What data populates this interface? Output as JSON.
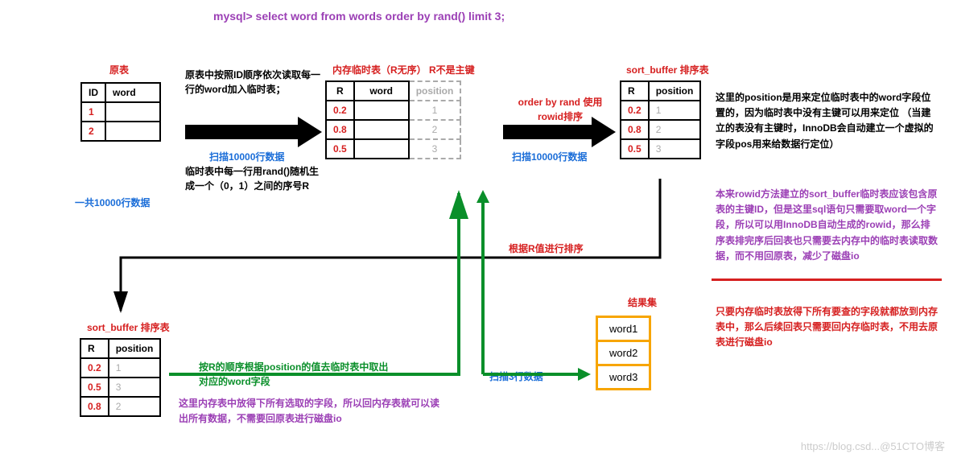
{
  "sql": "mysql> select word from words order by rand() limit 3;",
  "original": {
    "title": "原表",
    "headers": [
      "ID",
      "word"
    ],
    "rows": [
      [
        "1",
        ""
      ],
      [
        "2",
        ""
      ]
    ],
    "caption": "一共10000行数据"
  },
  "step1": {
    "desc": "原表中按照ID顺序依次读取每一行的word加入临时表；",
    "scan": "扫描10000行数据",
    "rand": "临时表中每一行用rand()随机生成一个（0，1）之间的序号R"
  },
  "temp": {
    "title": "内存临时表（R无序） R不是主键",
    "headers": [
      "R",
      "word",
      "position"
    ],
    "rows": [
      [
        "0.2",
        "",
        "1"
      ],
      [
        "0.8",
        "",
        "2"
      ],
      [
        "0.5",
        "",
        "3"
      ]
    ]
  },
  "step2": {
    "desc": "order by rand 使用rowid排序",
    "scan": "扫描10000行数据",
    "sortnote": "根据R值进行排序"
  },
  "sortbuf1": {
    "title": "sort_buffer 排序表",
    "headers": [
      "R",
      "position"
    ],
    "rows": [
      [
        "0.2",
        "1"
      ],
      [
        "0.8",
        "2"
      ],
      [
        "0.5",
        "3"
      ]
    ]
  },
  "note1": "这里的position是用来定位临时表中的word字段位置的，因为临时表中没有主键可以用来定位\n（当建立的表没有主键时，InnoDB会自动建立一个虚拟的字段pos用来给数据行定位）",
  "note2": "本来rowid方法建立的sort_buffer临时表应该包含原表的主键ID，但是这里sql语句只需要取word一个字段，所以可以用InnoDB自动生成的rowid，那么排序表排完序后回表也只需要去内存中的临时表读取数据，而不用回原表，减少了磁盘io",
  "note3": "只要内存临时表放得下所有要查的字段就都放到内存表中，那么后续回表只需要回内存临时表，不用去原表进行磁盘io",
  "sortbuf2": {
    "title": "sort_buffer 排序表",
    "headers": [
      "R",
      "position"
    ],
    "rows": [
      [
        "0.2",
        "1"
      ],
      [
        "0.5",
        "3"
      ],
      [
        "0.8",
        "2"
      ]
    ]
  },
  "step3": {
    "desc": "按R的顺序根据position的值去临时表中取出对应的word字段",
    "note": "这里内存表中放得下所有选取的字段，所以回内存表就可以读出所有数据，不需要回原表进行磁盘io",
    "scan": "扫描3行数据"
  },
  "result": {
    "title": "结果集",
    "rows": [
      "word1",
      "word2",
      "word3"
    ]
  },
  "watermark": "https://blog.csd...@51CTO博客"
}
